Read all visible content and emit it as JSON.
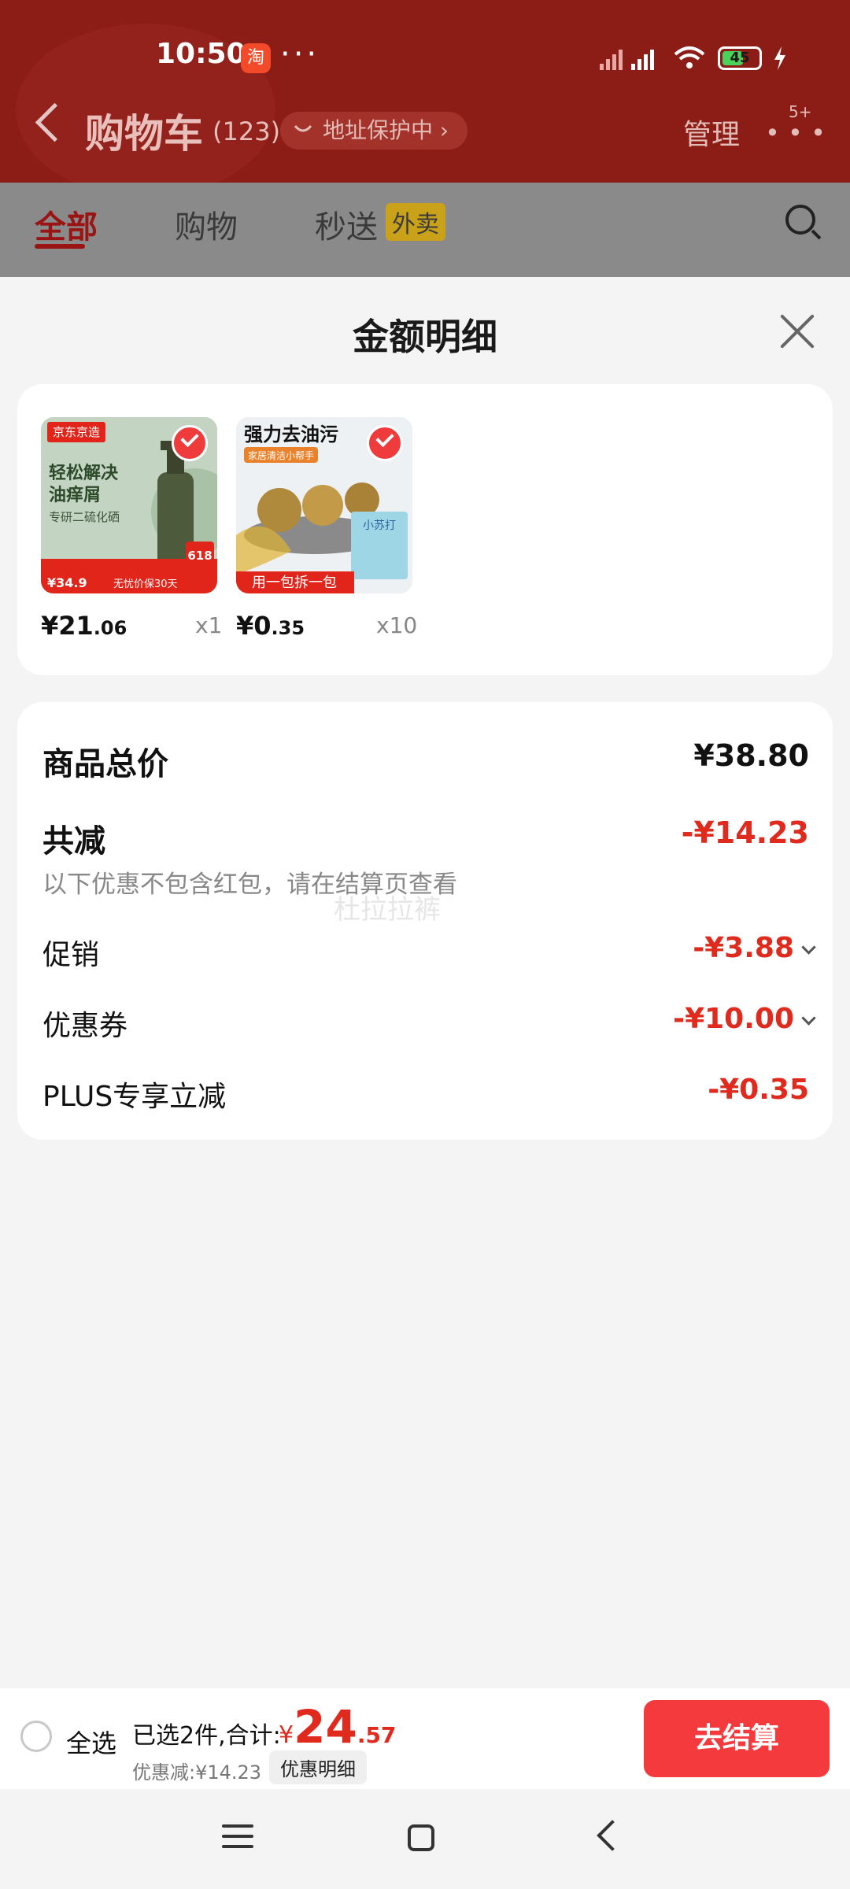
{
  "status": {
    "time": "10:50",
    "battery": "45"
  },
  "header": {
    "title": "购物车",
    "count": "(123)",
    "address_pill": "地址保护中",
    "manage": "管理",
    "notif_badge": "5+"
  },
  "tabs": {
    "all": "全部",
    "shopping": "购物",
    "instant": "秒送",
    "waimai": "外卖"
  },
  "sheet": {
    "title": "金额明细",
    "products": [
      {
        "price_int": "¥21",
        "price_dec": ".06",
        "qty": "x1",
        "brand": "京东京造",
        "headline": "轻松解决\n油痒屑",
        "sub": "专研二硫化硒",
        "tag_618": "618",
        "footer": "无忧价保30天",
        "small_price": "¥34.9"
      },
      {
        "price_int": "¥0",
        "price_dec": ".35",
        "qty": "x10",
        "headline": "强力去油污",
        "sub": "家居清洁小帮手",
        "banner": "用一包拆一包",
        "pack_label": "小苏打"
      }
    ],
    "summary": {
      "total_label": "商品总价",
      "total_value": "¥38.80",
      "reduce_label": "共减",
      "reduce_value": "-¥14.23",
      "note": "以下优惠不包含红包，请在结算页查看",
      "watermark": "杜拉拉裤",
      "promo_label": "促销",
      "promo_value": "-¥3.88",
      "coupon_label": "优惠券",
      "coupon_value": "-¥10.00",
      "plus_label": "PLUS专享立减",
      "plus_value": "-¥0.35"
    }
  },
  "bottom": {
    "select_all": "全选",
    "selected_text": "已选2件,合计:",
    "currency": "¥",
    "total_int": "24",
    "total_dec": ".57",
    "discount_text": "优惠减:¥14.23",
    "detail_chip": "优惠明细",
    "checkout": "去结算"
  },
  "colors": {
    "accent_red": "#e02a1e",
    "checkout_btn": "#f53a3e",
    "header_bg": "#8c1c16"
  }
}
